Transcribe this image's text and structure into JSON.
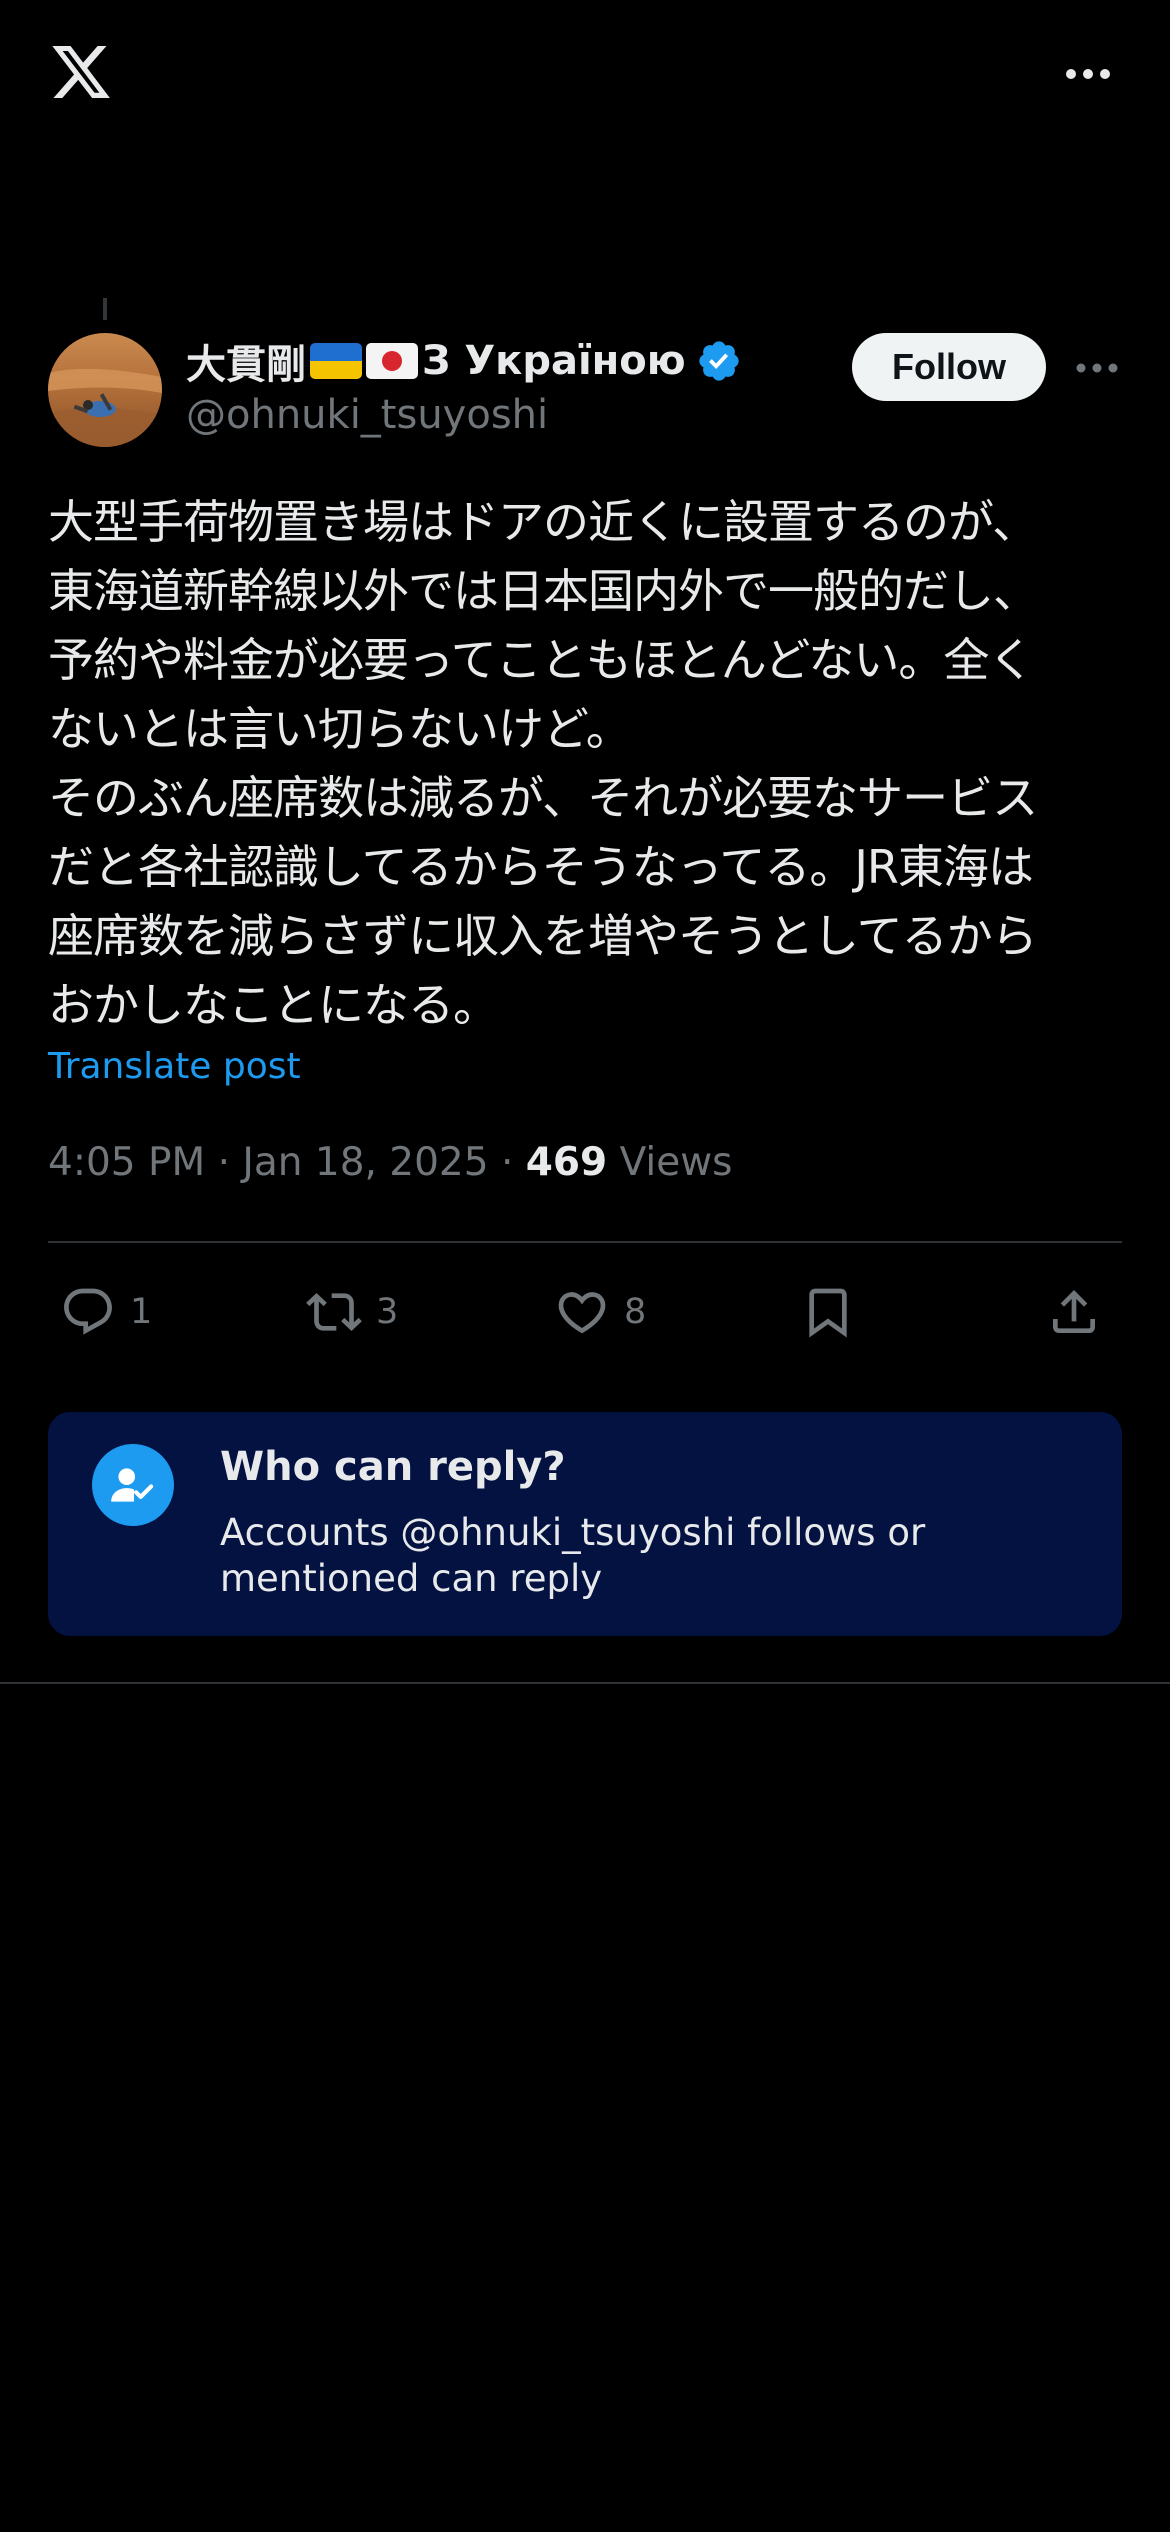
{
  "header": {
    "logo_icon": "x-logo-icon",
    "more_icon": "more-horizontal-icon"
  },
  "author": {
    "display_name": "大貫剛",
    "name_suffix": "З Україною",
    "flags": [
      "ukraine-flag",
      "japan-flag"
    ],
    "verified": true,
    "handle": "@ohnuki_tsuyoshi",
    "follow_label": "Follow"
  },
  "post": {
    "lines": [
      "大型手荷物置き場はドアの近くに設置するのが、",
      "東海道新幹線以外では日本国内外で一般的だし、",
      "予約や料金が必要ってこともほとんどない。全く",
      "ないとは言い切らないけど。",
      "そのぶん座席数は減るが、それが必要なサービス",
      "だと各社認識してるからそうなってる。JR東海は",
      "座席数を減らさずに収入を増やそうとしてるから",
      "おかしなことになる。"
    ],
    "translate_label": "Translate post"
  },
  "meta": {
    "time": "4:05 PM",
    "separator": "·",
    "date": "Jan 18, 2025",
    "views_count": "469",
    "views_label": "Views"
  },
  "actions": {
    "replies": "1",
    "reposts": "3",
    "likes": "8"
  },
  "reply_settings": {
    "title": "Who can reply?",
    "description": "Accounts @ohnuki_tsuyoshi follows or mentioned can reply"
  },
  "colors": {
    "background": "#000000",
    "text": "#e7e9ea",
    "muted": "#71767b",
    "accent": "#1d9bf0",
    "card_bg": "#031241"
  }
}
